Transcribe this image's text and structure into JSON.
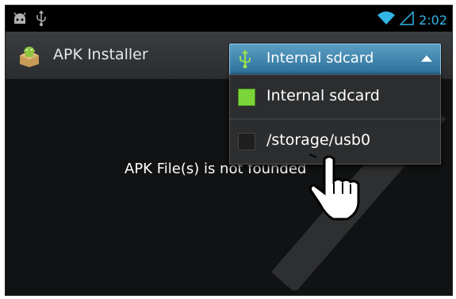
{
  "status_bar": {
    "time": "2:02",
    "left_icons": [
      "android-debug-icon",
      "usb-icon"
    ],
    "right_icons": [
      "wifi-icon",
      "signal-icon"
    ]
  },
  "app": {
    "title": "APK Installer",
    "icon": "package-icon"
  },
  "spinner": {
    "selected": "Internal sdcard",
    "icon": "usb-icon"
  },
  "dropdown": {
    "options": [
      {
        "label": "Internal sdcard",
        "checked": true
      },
      {
        "label": "/storage/usb0",
        "checked": false
      }
    ]
  },
  "content": {
    "message": "APK File(s) is not founded"
  },
  "colors": {
    "accent": "#33b5e5",
    "check_on": "#7bd43a",
    "spinner_top": "#5a9fc4",
    "spinner_bottom": "#2c6f99"
  }
}
